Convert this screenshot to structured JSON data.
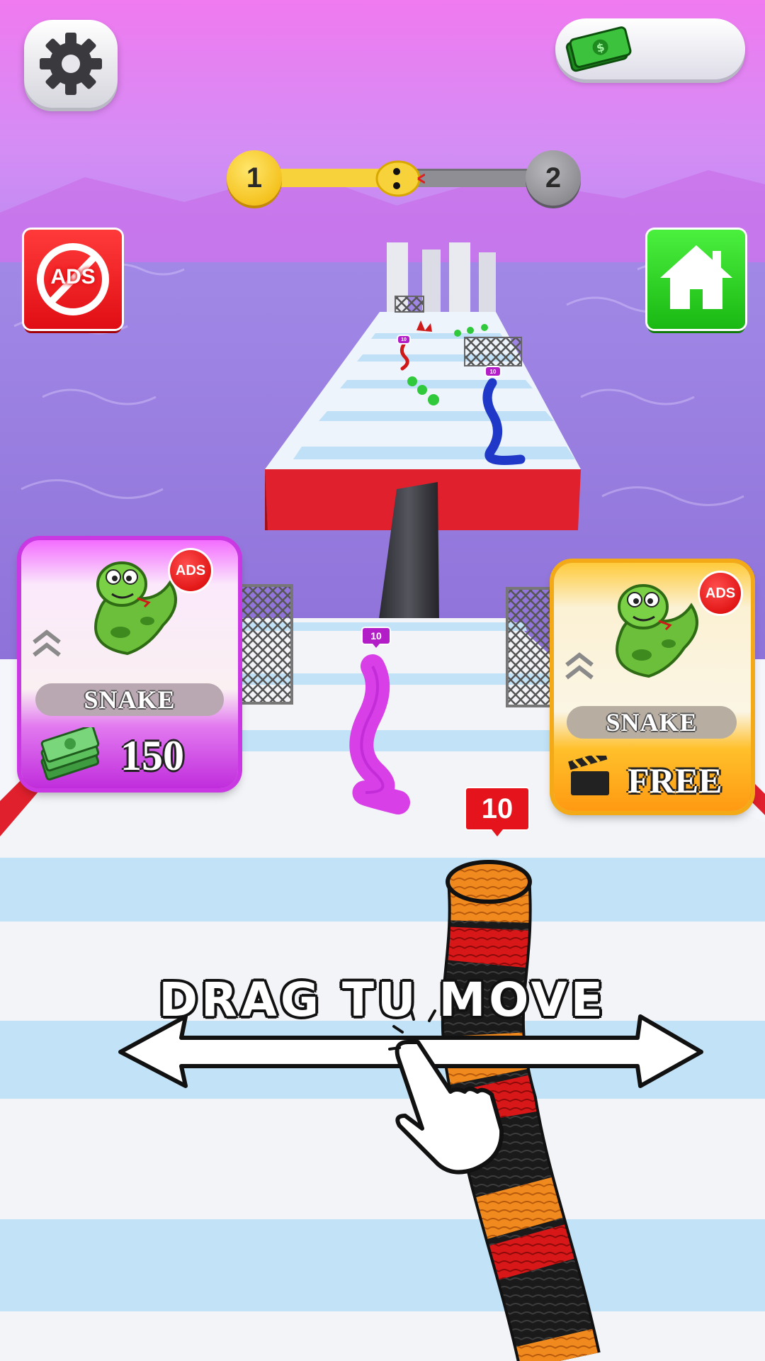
{
  "hud": {
    "money_value": "",
    "level_current": "1",
    "level_next": "2",
    "level_progress": 0.5
  },
  "buttons": {
    "no_ads_label": "ADS"
  },
  "cards": [
    {
      "ads_label": "ADS",
      "name": "SNAKE",
      "price": "150",
      "accent": "#c938e2"
    },
    {
      "ads_label": "ADS",
      "name": "SNAKE",
      "price": "FREE",
      "accent": "#f4a916"
    }
  ],
  "snakes": {
    "player_count": "10",
    "pink_count": "10",
    "blue_count": "10",
    "red_count": "10"
  },
  "tutorial": {
    "text": "DRAG TU MOVE"
  },
  "colors": {
    "sky_top": "#f27ff2",
    "sea": "#a98ce8",
    "track_red": "#e0202c",
    "stripe_blue": "#b6dcf6"
  }
}
